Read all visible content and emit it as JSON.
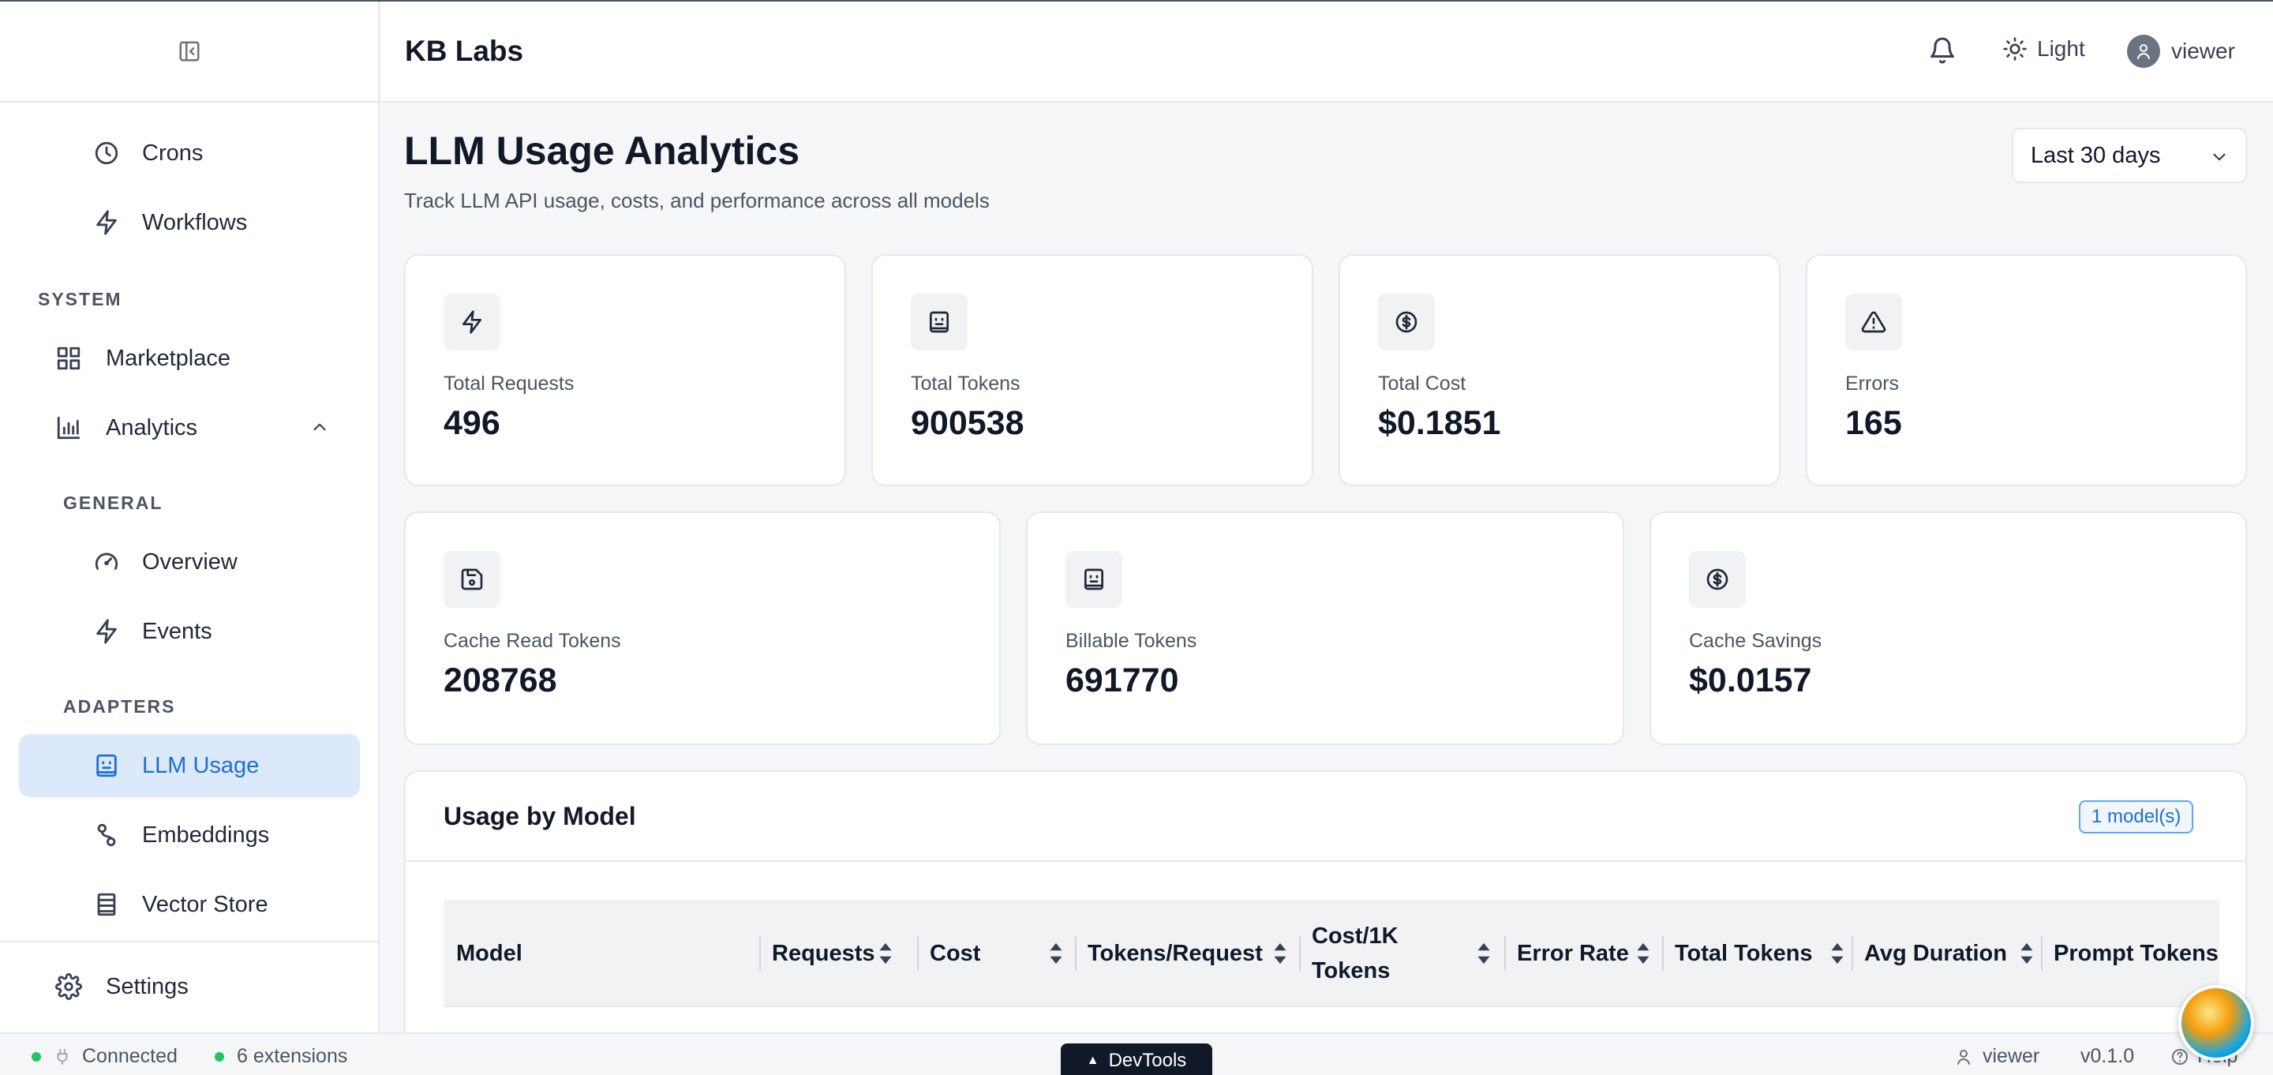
{
  "app": {
    "brand": "KB Labs"
  },
  "header": {
    "theme_label": "Light",
    "user_label": "viewer"
  },
  "sidebar": {
    "items_top": [
      {
        "label": "Crons",
        "icon": "clock-icon"
      },
      {
        "label": "Workflows",
        "icon": "zap-icon"
      }
    ],
    "section_system": "SYSTEM",
    "marketplace": "Marketplace",
    "analytics": "Analytics",
    "section_general": "GENERAL",
    "overview": "Overview",
    "events": "Events",
    "section_adapters": "ADAPTERS",
    "llm_usage": "LLM Usage",
    "embeddings": "Embeddings",
    "vector_store": "Vector Store",
    "settings": "Settings"
  },
  "page": {
    "title": "LLM Usage Analytics",
    "subtitle": "Track LLM API usage, costs, and performance across all models",
    "range": "Last 30 days"
  },
  "stats": {
    "total_requests": {
      "label": "Total Requests",
      "value": "496"
    },
    "total_tokens": {
      "label": "Total Tokens",
      "value": "900538"
    },
    "total_cost": {
      "label": "Total Cost",
      "value": "$0.1851"
    },
    "errors": {
      "label": "Errors",
      "value": "165"
    },
    "cache_read": {
      "label": "Cache Read Tokens",
      "value": "208768"
    },
    "billable": {
      "label": "Billable Tokens",
      "value": "691770"
    },
    "cache_savings": {
      "label": "Cache Savings",
      "value": "$0.0157"
    }
  },
  "usage": {
    "title": "Usage by Model",
    "badge": "1 model(s)",
    "columns": [
      "Model",
      "Requests",
      "Cost",
      "Tokens/Request",
      "Cost/1K",
      "Tokens",
      "Error Rate",
      "Total Tokens",
      "Avg Duration",
      "Prompt Tokens"
    ]
  },
  "status": {
    "connected": "Connected",
    "extensions": "6 extensions",
    "devtools": "DevTools",
    "user": "viewer",
    "version": "v0.1.0",
    "help": "Help"
  }
}
